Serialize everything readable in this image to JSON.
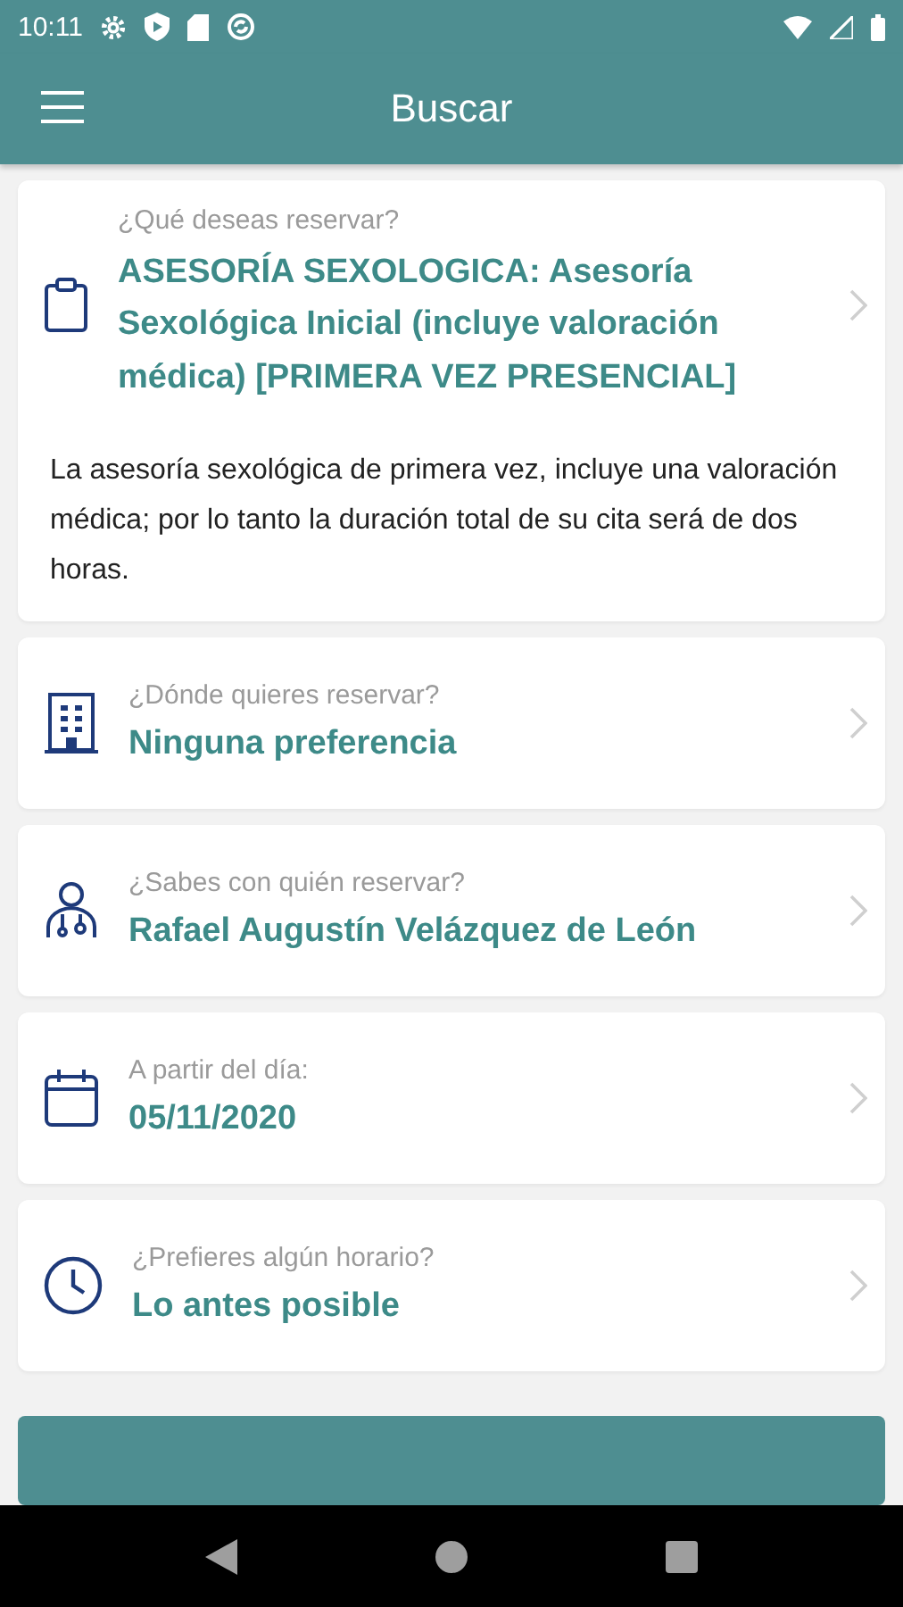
{
  "status_bar": {
    "time": "10:11"
  },
  "app_bar": {
    "title": "Buscar"
  },
  "options": [
    {
      "kind": "service",
      "label": "¿Qué deseas reservar?",
      "value": "ASESORÍA SEXOLOGICA: Asesoría Sexológica Inicial (incluye valoración médica) [PRIMERA VEZ PRESENCIAL]",
      "description": "La asesoría sexológica de primera vez, incluye una valoración médica; por lo tanto la duración total de su cita será de dos horas."
    },
    {
      "kind": "location",
      "label": "¿Dónde quieres reservar?",
      "value": "Ninguna preferencia"
    },
    {
      "kind": "professional",
      "label": "¿Sabes con quién reservar?",
      "value": "Rafael Augustín Velázquez de León"
    },
    {
      "kind": "date",
      "label": "A partir del día:",
      "value": "05/11/2020"
    },
    {
      "kind": "time",
      "label": "¿Prefieres algún horario?",
      "value": "Lo antes posible"
    }
  ]
}
